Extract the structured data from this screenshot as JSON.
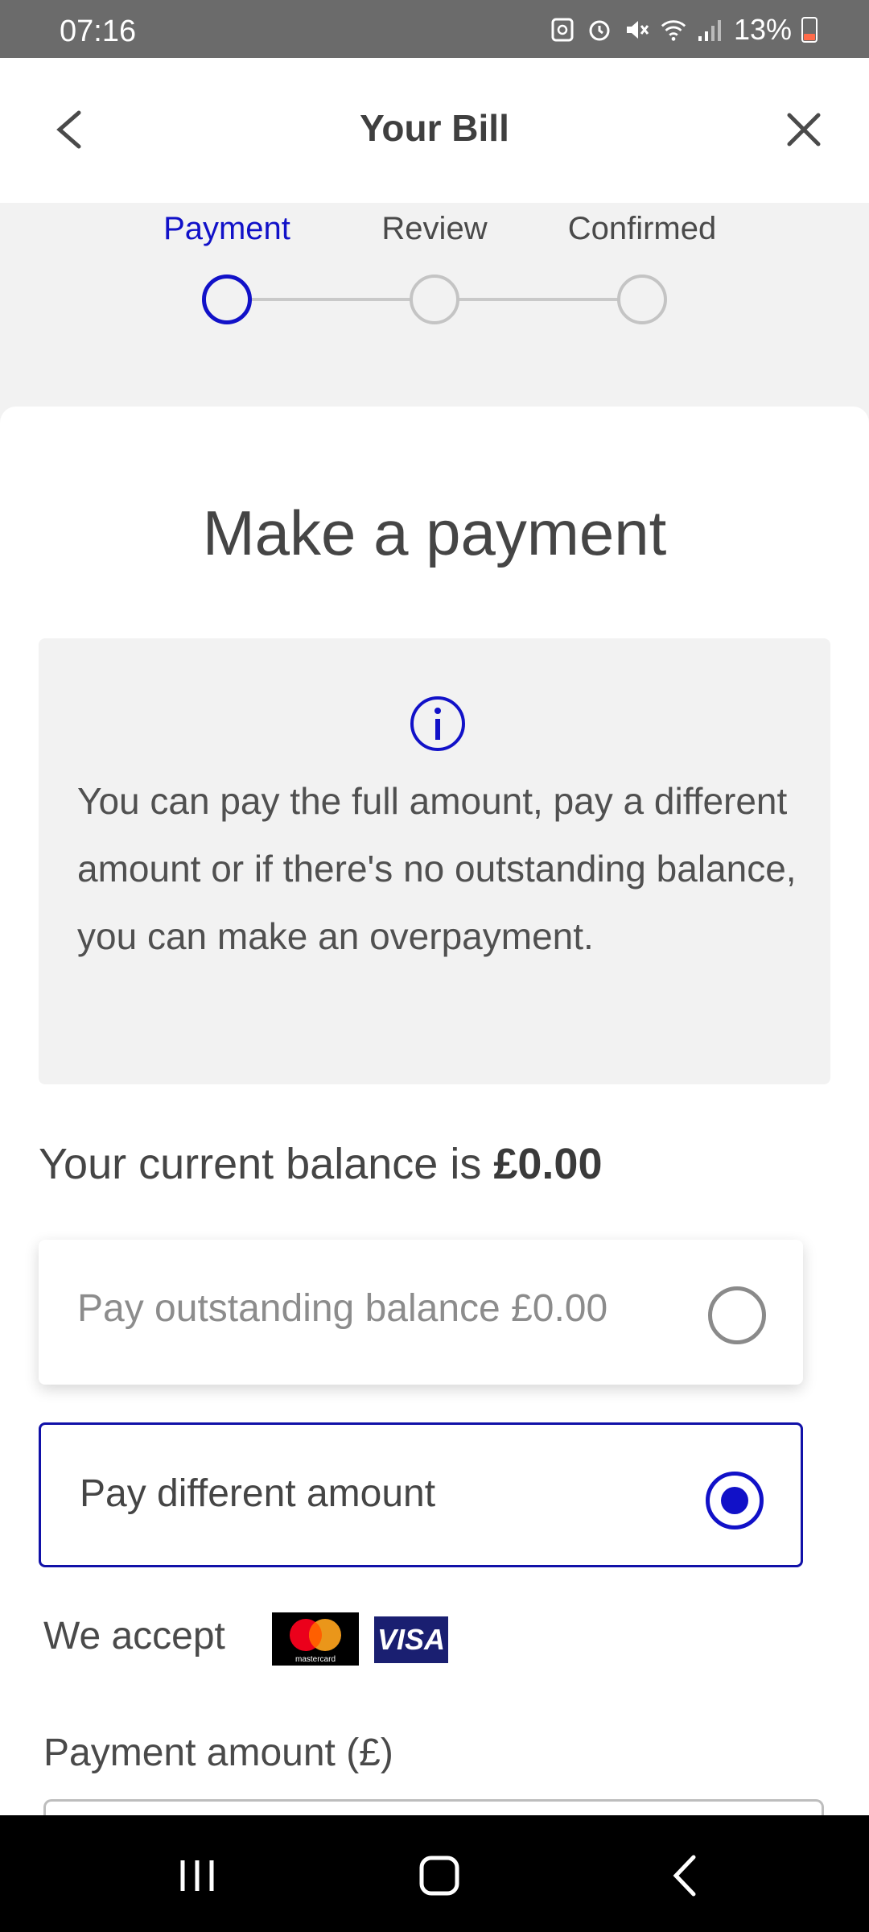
{
  "status_bar": {
    "time": "07:16",
    "battery": "13%",
    "icons": [
      "sync-icon",
      "alarm-icon",
      "mute-icon",
      "wifi-icon",
      "signal-icon",
      "battery-icon"
    ]
  },
  "header": {
    "title": "Your Bill",
    "back_icon": "chevron-left-icon",
    "close_icon": "close-icon"
  },
  "stepper": {
    "steps": [
      {
        "label": "Payment",
        "active": true
      },
      {
        "label": "Review",
        "active": false
      },
      {
        "label": "Confirmed",
        "active": false
      }
    ]
  },
  "main": {
    "title": "Make a payment",
    "info_text": "You can pay the full amount, pay a different amount or if there's no outstanding balance, you can make an overpayment.",
    "balance_prefix": "Your current balance is ",
    "balance_value": "£0.00",
    "options": [
      {
        "label": "Pay outstanding balance £0.00",
        "selected": false
      },
      {
        "label": "Pay different amount",
        "selected": true
      }
    ],
    "accept_label": "We accept",
    "cards": [
      "mastercard",
      "VISA"
    ],
    "amount_label": "Payment amount (£)"
  },
  "colors": {
    "accent": "#1111c8",
    "background": "#f2f2f2",
    "text": "#4a4a4a"
  }
}
